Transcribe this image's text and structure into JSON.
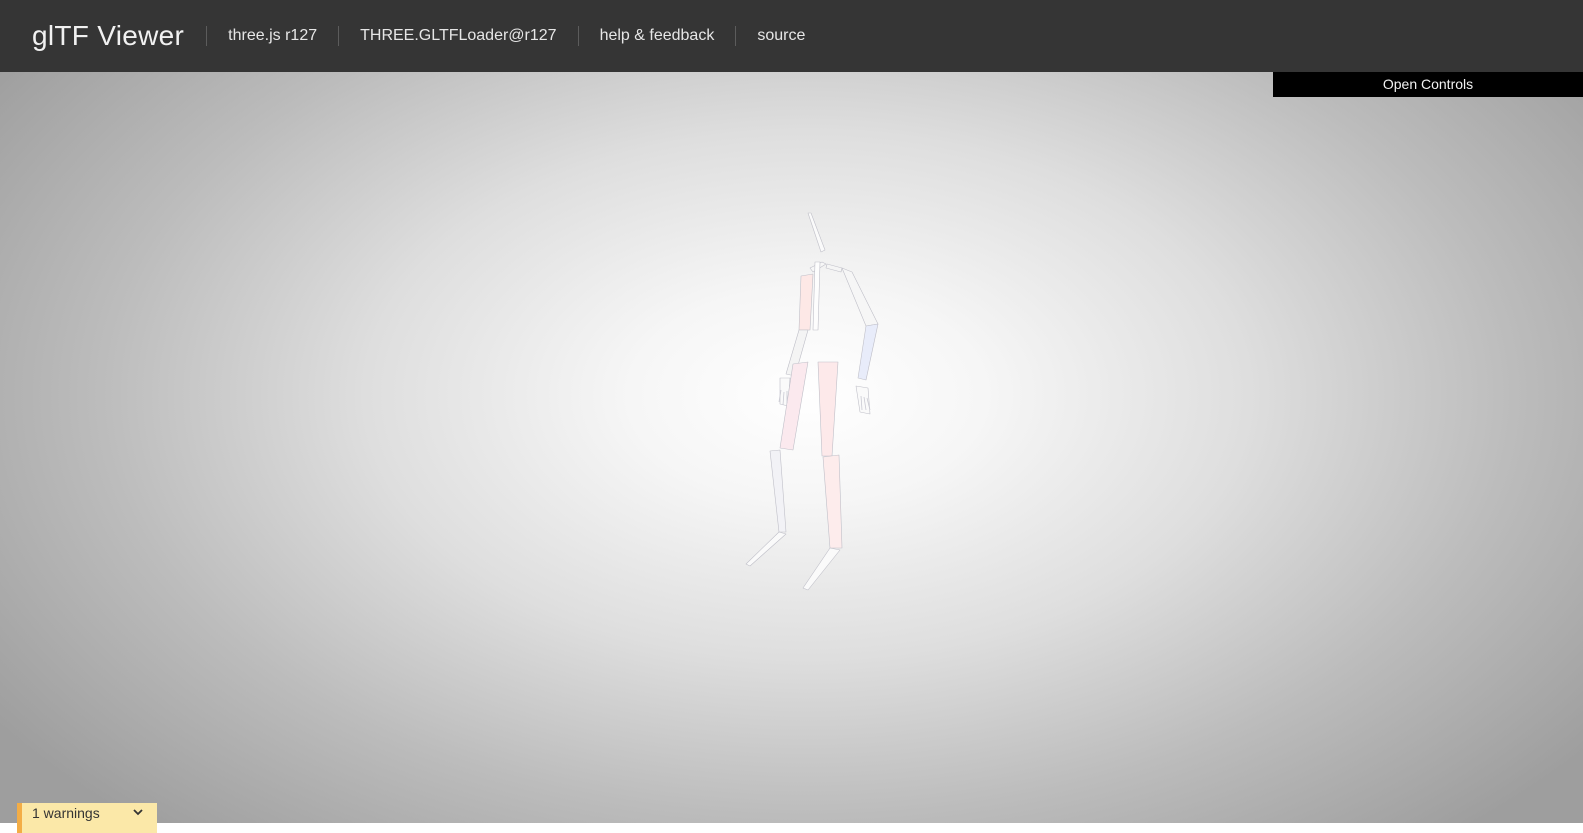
{
  "header": {
    "title": "glTF Viewer",
    "nav": [
      {
        "label": "three.js r127"
      },
      {
        "label": "THREE.GLTFLoader@r127"
      },
      {
        "label": "help & feedback"
      },
      {
        "label": "source"
      }
    ]
  },
  "controls": {
    "toggle_label": "Open Controls"
  },
  "validation": {
    "warnings_label": "1 warnings"
  },
  "icons": {
    "warnings_toggle": "chevron-down-icon"
  },
  "colors": {
    "header_bg": "#353535",
    "controls_bg": "#000000",
    "warning_bg": "#fbe8a8",
    "warning_accent": "#f3ad46"
  }
}
